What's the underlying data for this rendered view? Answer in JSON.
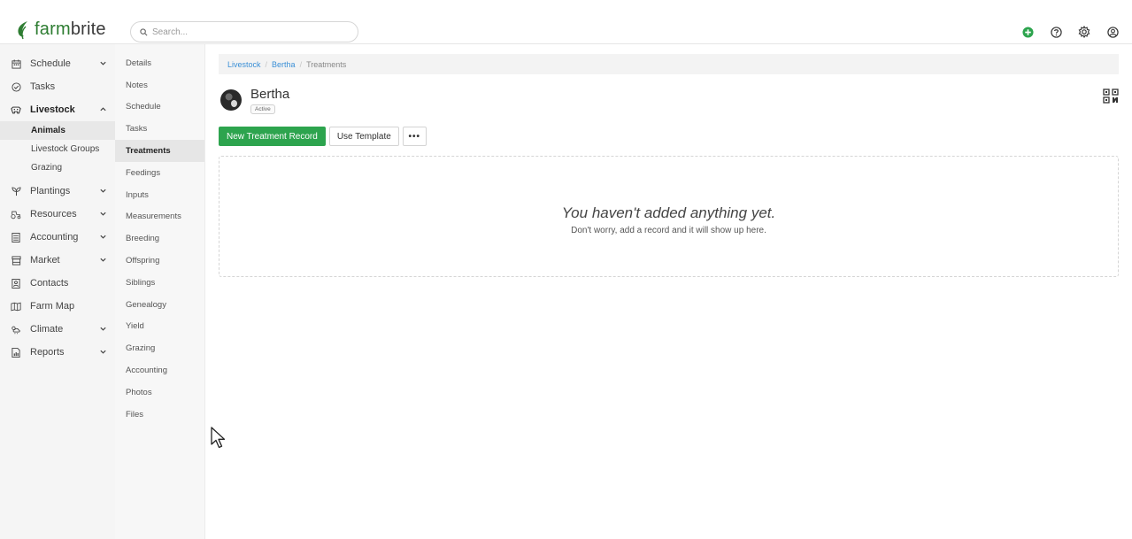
{
  "brand": {
    "logo_prefix": "farm",
    "logo_suffix": "brite",
    "accent": "#2da44e"
  },
  "search": {
    "placeholder": "Search..."
  },
  "header_icons": [
    "add-circle-icon",
    "help-icon",
    "settings-gear-icon",
    "user-account-icon"
  ],
  "sidebar": {
    "items": [
      {
        "label": "Schedule",
        "icon": "calendar-icon",
        "chevron": "down"
      },
      {
        "label": "Tasks",
        "icon": "check-circle-icon"
      },
      {
        "label": "Livestock",
        "icon": "cow-icon",
        "chevron": "up",
        "expanded": true
      },
      {
        "label": "Plantings",
        "icon": "sprout-icon",
        "chevron": "down"
      },
      {
        "label": "Resources",
        "icon": "tractor-icon",
        "chevron": "down"
      },
      {
        "label": "Accounting",
        "icon": "calculator-icon",
        "chevron": "down"
      },
      {
        "label": "Market",
        "icon": "store-icon",
        "chevron": "down"
      },
      {
        "label": "Contacts",
        "icon": "contact-card-icon"
      },
      {
        "label": "Farm Map",
        "icon": "map-icon"
      },
      {
        "label": "Climate",
        "icon": "weather-icon",
        "chevron": "down"
      },
      {
        "label": "Reports",
        "icon": "report-icon",
        "chevron": "down"
      }
    ],
    "livestock_sub": [
      "Animals",
      "Livestock Groups",
      "Grazing"
    ],
    "active_sub": "Animals"
  },
  "subnav": {
    "items": [
      "Details",
      "Notes",
      "Schedule",
      "Tasks",
      "Treatments",
      "Feedings",
      "Inputs",
      "Measurements",
      "Breeding",
      "Offspring",
      "Siblings",
      "Genealogy",
      "Yield",
      "Grazing",
      "Accounting",
      "Photos",
      "Files"
    ],
    "active": "Treatments"
  },
  "breadcrumb": {
    "root": "Livestock",
    "animal": "Bertha",
    "current": "Treatments"
  },
  "animal": {
    "name": "Bertha",
    "status": "Active"
  },
  "actions": {
    "new_record": "New Treatment Record",
    "use_template": "Use Template",
    "more": "•••"
  },
  "empty_state": {
    "title": "You haven't added anything yet.",
    "subtitle": "Don't worry, add a record and it will show up here."
  }
}
